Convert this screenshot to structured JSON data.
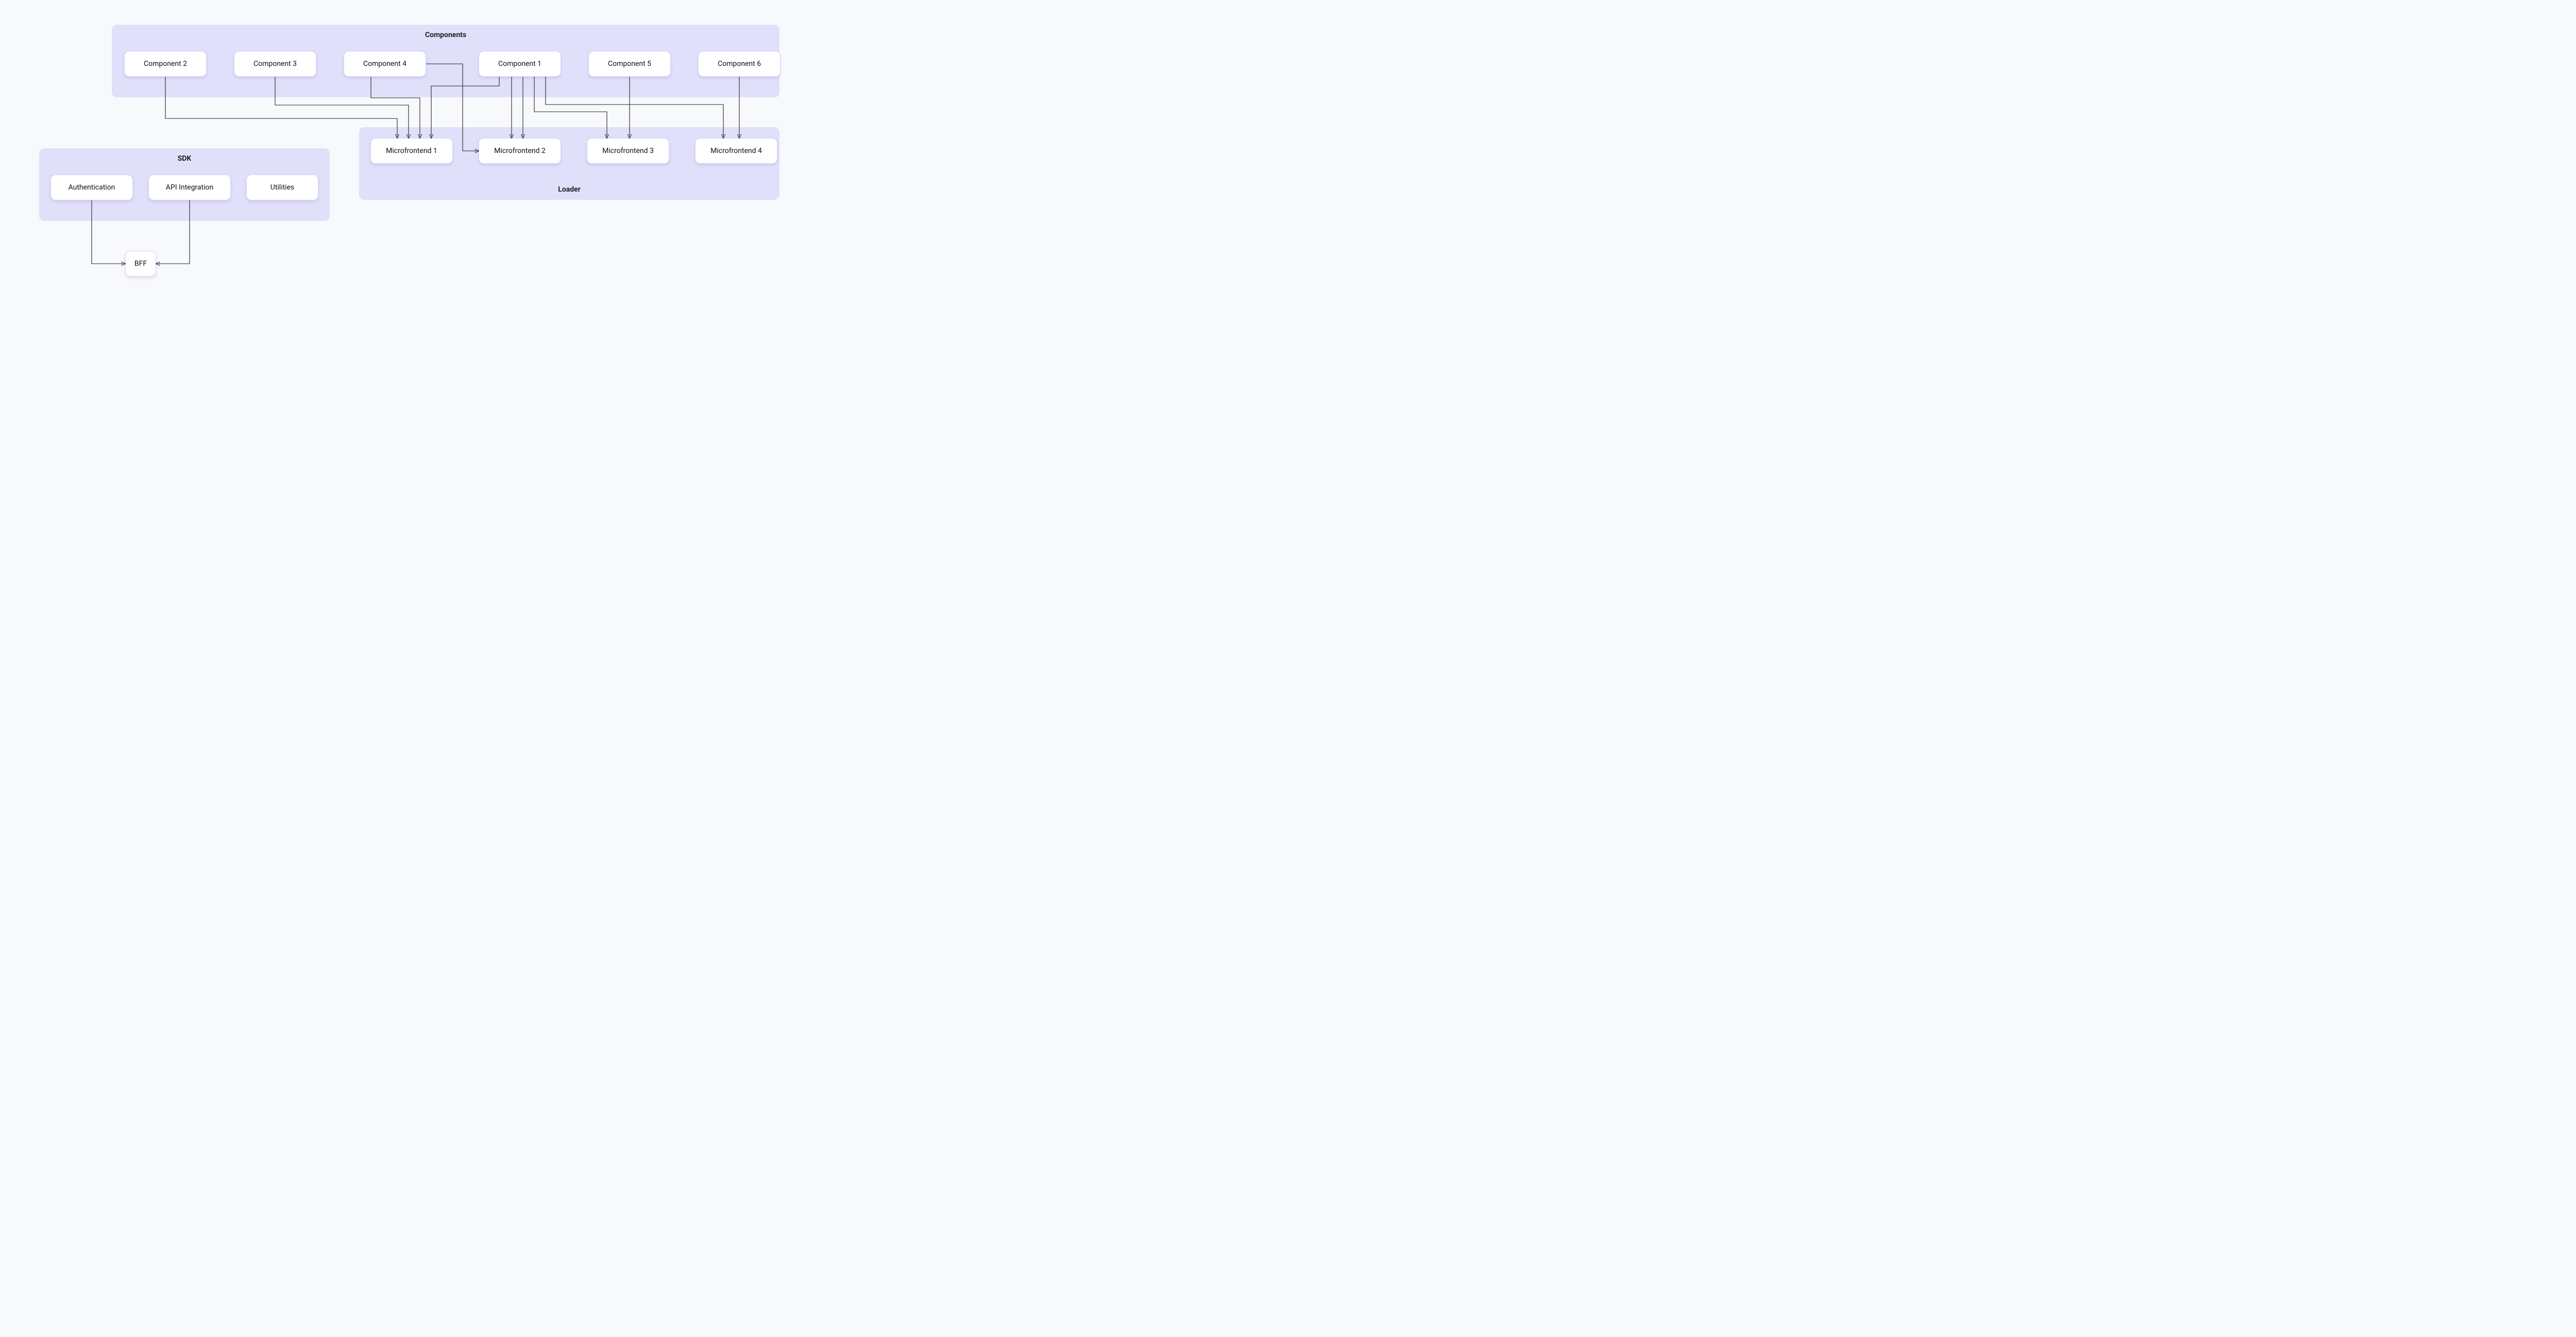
{
  "groups": {
    "components": {
      "title": "Components"
    },
    "loader": {
      "title": "Loader"
    },
    "sdk": {
      "title": "SDK"
    }
  },
  "nodes": {
    "comp2": {
      "label": "Component 2"
    },
    "comp3": {
      "label": "Component 3"
    },
    "comp4": {
      "label": "Component 4"
    },
    "comp1": {
      "label": "Component 1"
    },
    "comp5": {
      "label": "Component 5"
    },
    "comp6": {
      "label": "Component 6"
    },
    "mf1": {
      "label": "Microfrontend 1"
    },
    "mf2": {
      "label": "Microfrontend 2"
    },
    "mf3": {
      "label": "Microfrontend 3"
    },
    "mf4": {
      "label": "Microfrontend 4"
    },
    "auth": {
      "label": "Authentication"
    },
    "api": {
      "label": "API Integration"
    },
    "util": {
      "label": "Utilities"
    },
    "bff": {
      "label": "BFF"
    }
  },
  "edges": [
    {
      "from": "comp2",
      "to": "mf1"
    },
    {
      "from": "comp3",
      "to": "mf1"
    },
    {
      "from": "comp4",
      "to": "mf1"
    },
    {
      "from": "comp4",
      "to": "mf2"
    },
    {
      "from": "comp1",
      "to": "mf1"
    },
    {
      "from": "comp1",
      "to": "mf2"
    },
    {
      "from": "comp1",
      "to": "mf2"
    },
    {
      "from": "comp1",
      "to": "mf3"
    },
    {
      "from": "comp1",
      "to": "mf4"
    },
    {
      "from": "comp5",
      "to": "mf3"
    },
    {
      "from": "comp6",
      "to": "mf4"
    },
    {
      "from": "auth",
      "to": "bff"
    },
    {
      "from": "api",
      "to": "bff"
    }
  ]
}
